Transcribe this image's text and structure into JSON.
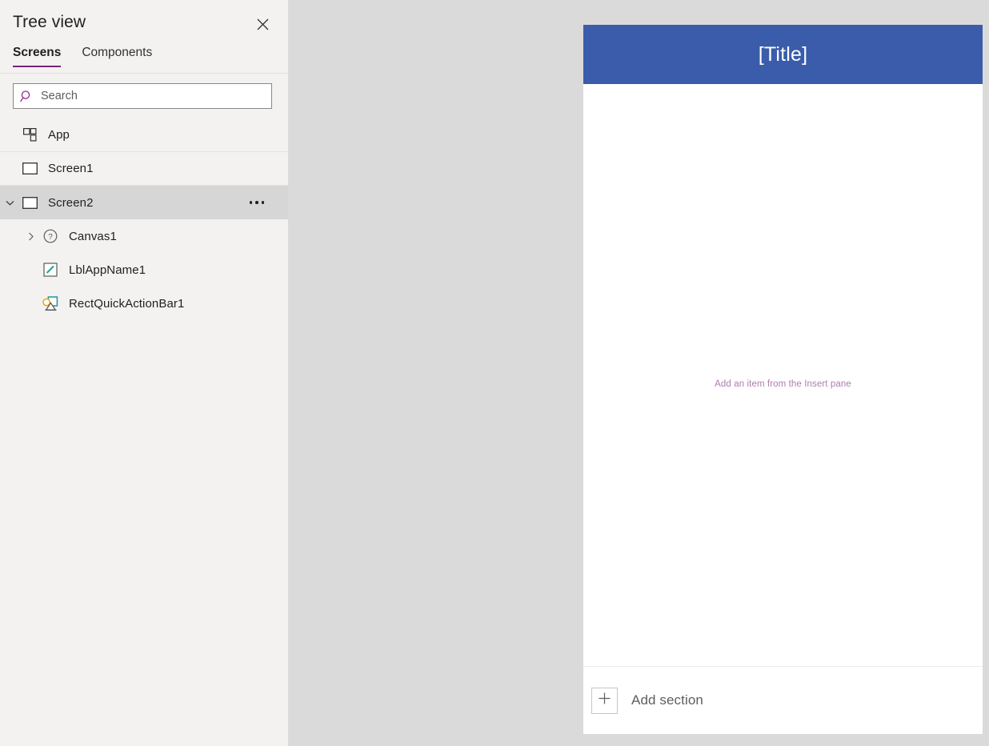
{
  "panel": {
    "title": "Tree view",
    "close_icon": "close-icon",
    "tabs": [
      {
        "label": "Screens",
        "active": true
      },
      {
        "label": "Components",
        "active": false
      }
    ],
    "accent_color": "#742774",
    "search": {
      "placeholder": "Search",
      "value": "",
      "icon": "search-icon"
    },
    "tree_items": [
      {
        "label": "App",
        "icon": "app-grid-icon",
        "chevron": "none",
        "indent": 0,
        "selected": false,
        "divider": true,
        "ellipsis": false
      },
      {
        "label": "Screen1",
        "icon": "screen-rect-icon",
        "chevron": "none",
        "indent": 0,
        "selected": false,
        "divider": true,
        "ellipsis": false
      },
      {
        "label": "Screen2",
        "icon": "screen-rect-icon",
        "chevron": "down",
        "indent": 0,
        "selected": true,
        "divider": false,
        "ellipsis": true
      },
      {
        "label": "Canvas1",
        "icon": "question-circle-icon",
        "chevron": "right",
        "indent": 1,
        "selected": false,
        "divider": false,
        "ellipsis": false
      },
      {
        "label": "LblAppName1",
        "icon": "label-pencil-icon",
        "chevron": "none",
        "indent": 1,
        "selected": false,
        "divider": false,
        "ellipsis": false
      },
      {
        "label": "RectQuickActionBar1",
        "icon": "shapes-icon",
        "chevron": "none",
        "indent": 1,
        "selected": false,
        "divider": false,
        "ellipsis": false
      }
    ]
  },
  "canvas": {
    "background_color": "#dadada",
    "screen": {
      "title": "[Title]",
      "titlebar_color": "#3a5cab",
      "title_color": "#ffffff",
      "placeholder_text": "Add an item from the Insert pane",
      "placeholder_color": "#b07cb0",
      "footer": {
        "add_icon": "plus-icon",
        "add_label": "Add section"
      }
    }
  }
}
